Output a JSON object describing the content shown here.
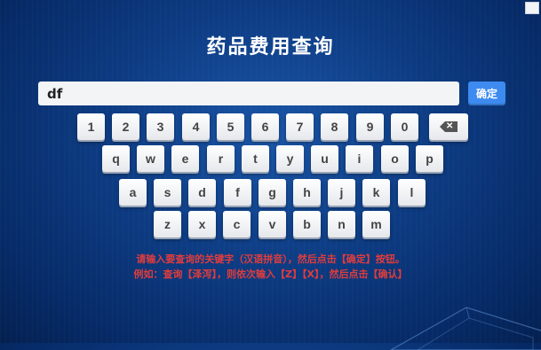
{
  "page": {
    "title": "药品费用查询"
  },
  "search": {
    "value": "df",
    "confirm_label": "确定"
  },
  "keyboard": {
    "row1": [
      "1",
      "2",
      "3",
      "4",
      "5",
      "6",
      "7",
      "8",
      "9",
      "0"
    ],
    "row2": [
      "q",
      "w",
      "e",
      "r",
      "t",
      "y",
      "u",
      "i",
      "o",
      "p"
    ],
    "row3": [
      "a",
      "s",
      "d",
      "f",
      "g",
      "h",
      "j",
      "k",
      "l"
    ],
    "row4": [
      "z",
      "x",
      "c",
      "v",
      "b",
      "n",
      "m"
    ],
    "backspace_icon": "backspace-icon"
  },
  "instructions": {
    "line1": "请输入要查询的关键字（汉语拼音），然后点击【确定】按钮。",
    "line2": "例如：查询【泽泻】，则依次输入【Z】【X】，然后点击【确认】"
  },
  "colors": {
    "background": "#0d3b82",
    "accent_button": "#3d8bf0",
    "instruction_text": "#e23c3c",
    "key_face": "#ffffff"
  }
}
